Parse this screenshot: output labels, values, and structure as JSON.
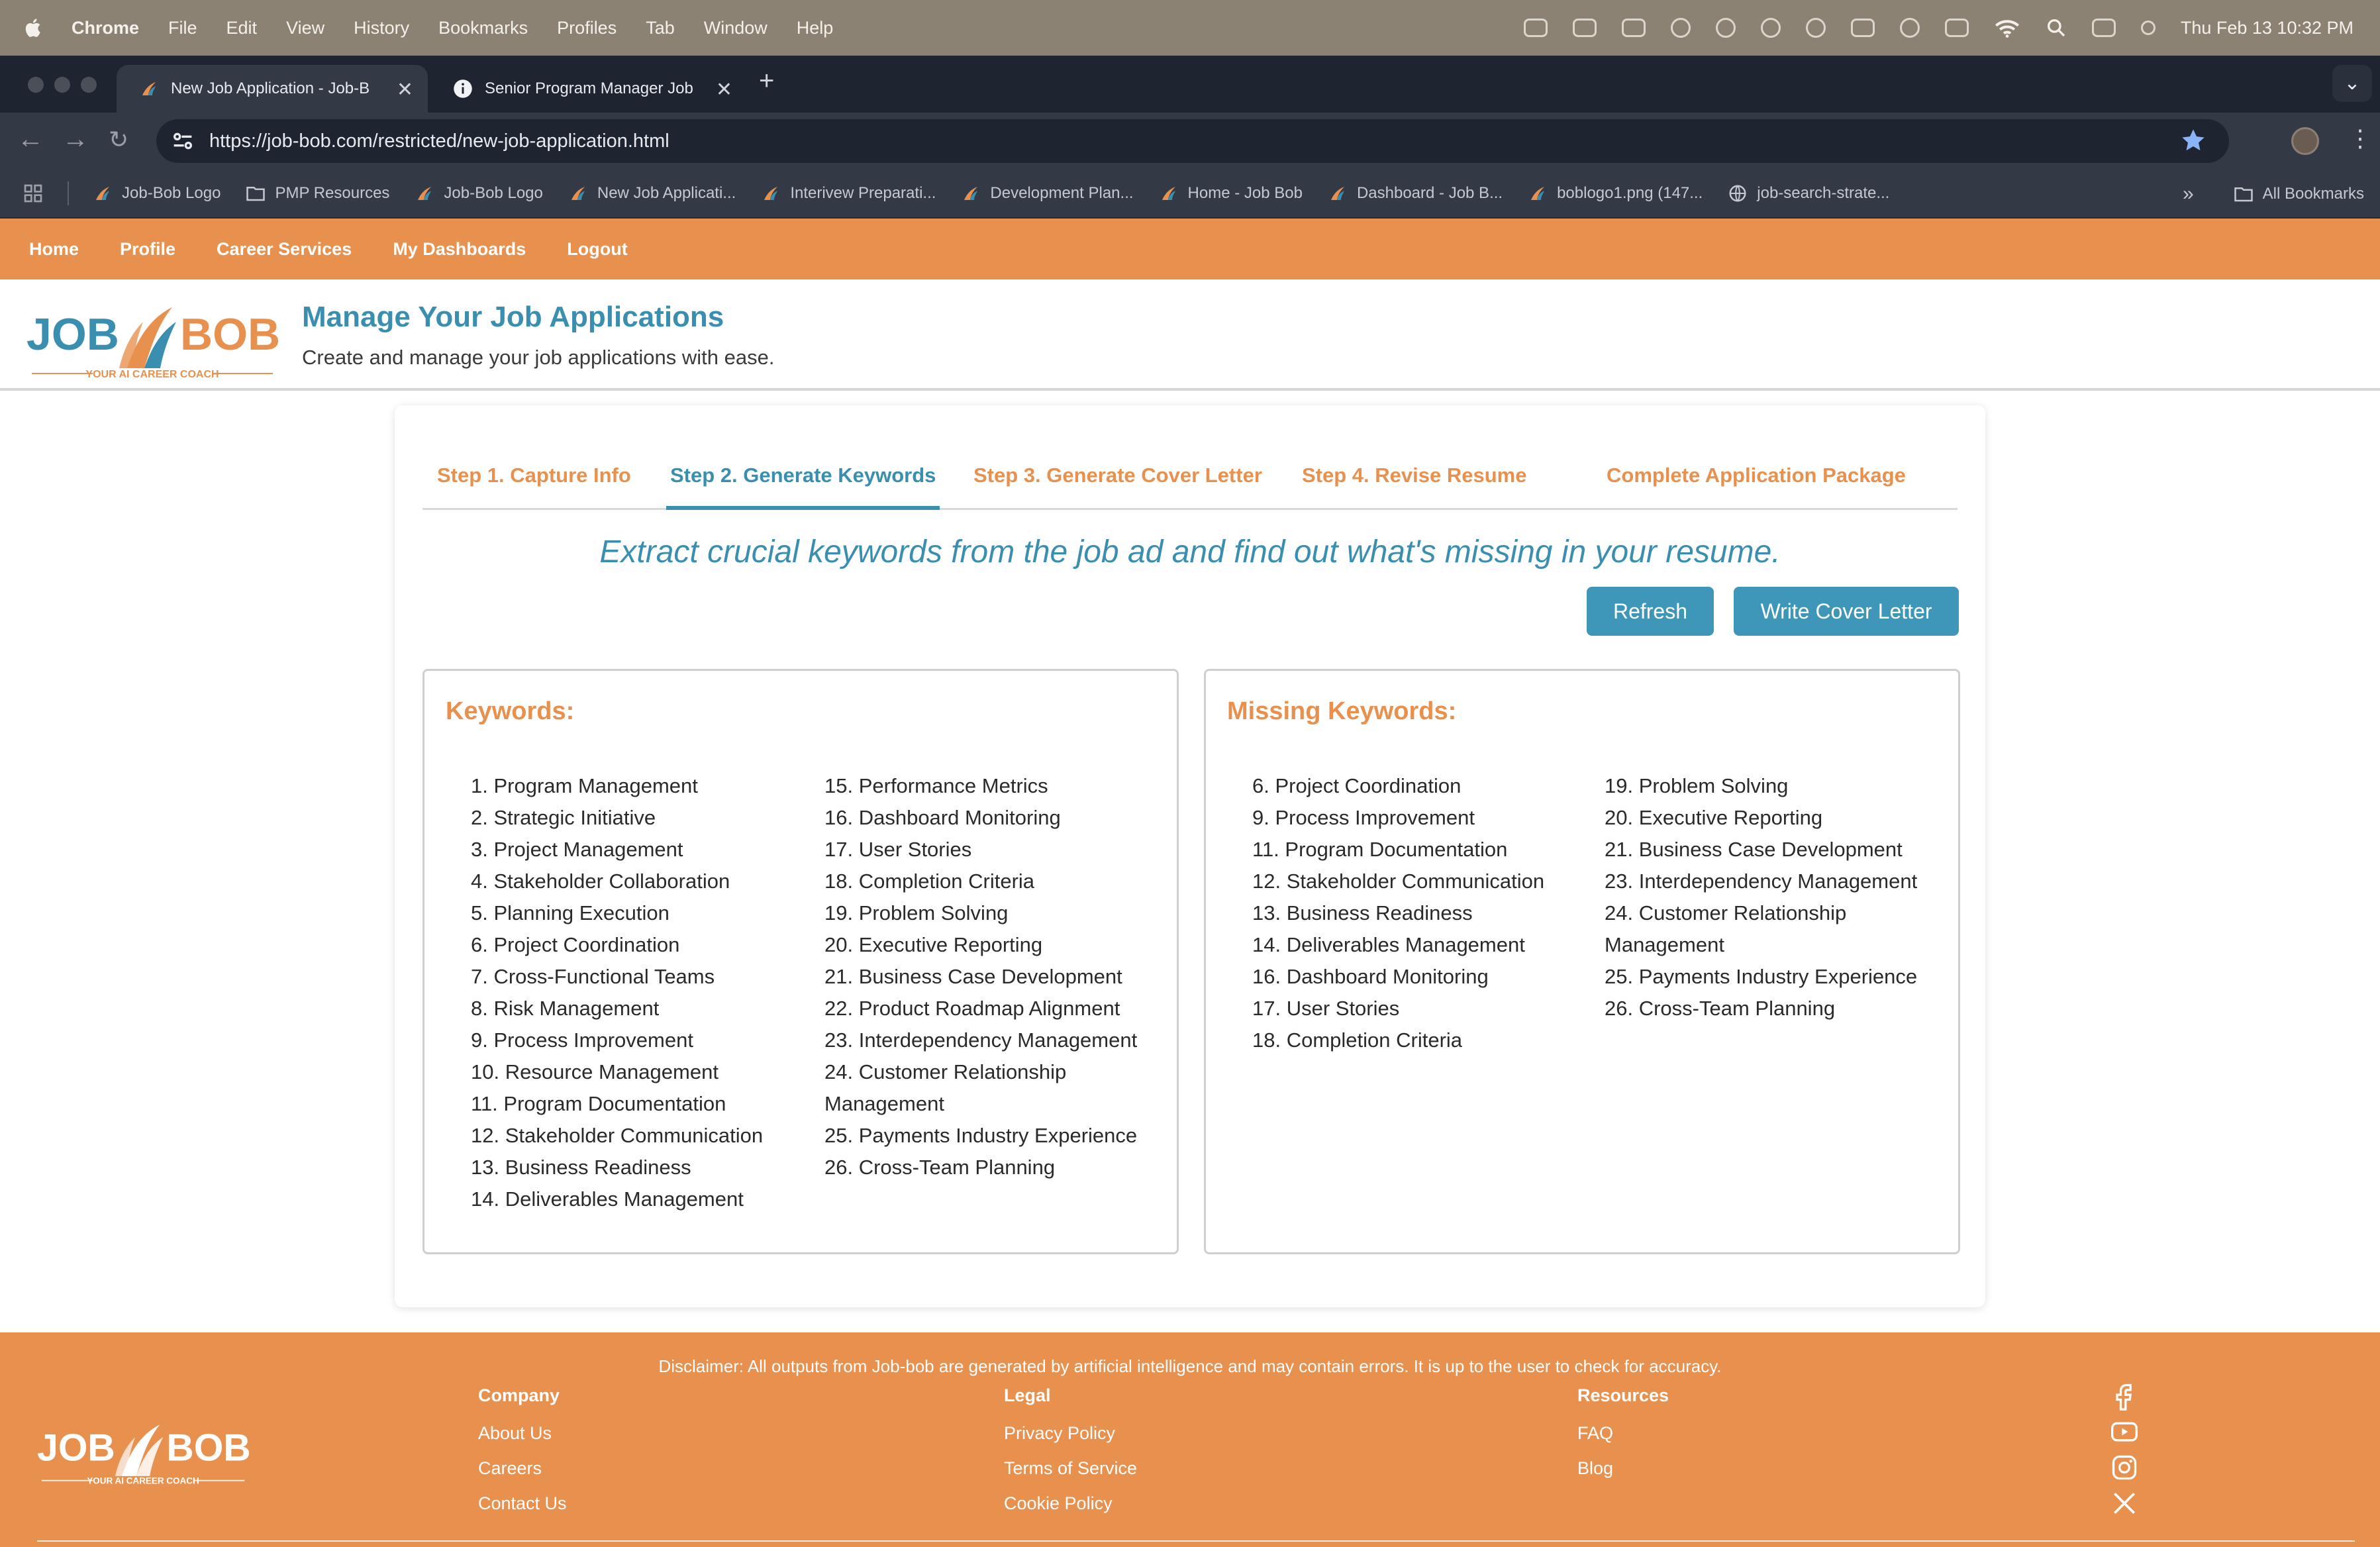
{
  "menubar": {
    "app": "Chrome",
    "items": [
      "File",
      "Edit",
      "View",
      "History",
      "Bookmarks",
      "Profiles",
      "Tab",
      "Window",
      "Help"
    ],
    "clock": "Thu Feb 13  10:32 PM"
  },
  "browser": {
    "tabs": [
      {
        "label": "New Job Application - Job-B",
        "active": true
      },
      {
        "label": "Senior Program Manager Job",
        "active": false
      }
    ],
    "url": "https://job-bob.com/restricted/new-job-application.html",
    "bookmarks": [
      "Job-Bob Logo",
      "PMP Resources",
      "Job-Bob Logo",
      "New Job Applicati...",
      "Interivew Preparati...",
      "Development Plan...",
      "Home - Job Bob",
      "Dashboard - Job B...",
      "boblogo1.png (147...",
      "job-search-strate..."
    ],
    "all_bookmarks": "All Bookmarks",
    "overflow": "»"
  },
  "nav": {
    "items": [
      "Home",
      "Profile",
      "Career Services",
      "My Dashboards",
      "Logout"
    ]
  },
  "brand": {
    "left": "JOB",
    "right": "BOB",
    "tagline": "YOUR AI CAREER COACH"
  },
  "header": {
    "title": "Manage Your Job Applications",
    "subtitle": "Create and manage your job applications with ease."
  },
  "steps": [
    "Step 1. Capture Info",
    "Step 2. Generate Keywords",
    "Step 3. Generate Cover Letter",
    "Step 4. Revise Resume",
    "Complete Application Package"
  ],
  "main": {
    "heading": "Extract crucial keywords from the job ad and find out what's missing in your resume.",
    "refresh_label": "Refresh",
    "cover_label": "Write Cover Letter"
  },
  "keywords": {
    "title": "Keywords:",
    "col1": [
      "1. Program Management",
      "2. Strategic Initiative",
      "3. Project Management",
      "4. Stakeholder Collaboration",
      "5. Planning Execution",
      "6. Project Coordination",
      "7. Cross-Functional Teams",
      "8. Risk Management",
      "9. Process Improvement",
      "10. Resource Management",
      "11. Program Documentation",
      "12. Stakeholder Communication",
      "13. Business Readiness",
      "14. Deliverables Management"
    ],
    "col2": [
      "15. Performance Metrics",
      "16. Dashboard Monitoring",
      "17. User Stories",
      "18. Completion Criteria",
      "19. Problem Solving",
      "20. Executive Reporting",
      "21. Business Case Development",
      "22. Product Roadmap Alignment",
      "23. Interdependency Management",
      "24. Customer Relationship Management",
      "25. Payments Industry Experience",
      "26. Cross-Team Planning"
    ]
  },
  "missing": {
    "title": "Missing Keywords:",
    "col1": [
      "6. Project Coordination",
      "9. Process Improvement",
      "11. Program Documentation",
      "12. Stakeholder Communication",
      "13. Business Readiness",
      "14. Deliverables Management",
      "16. Dashboard Monitoring",
      "17. User Stories",
      "18. Completion Criteria"
    ],
    "col2": [
      "19. Problem Solving",
      "20. Executive Reporting",
      "21. Business Case Development",
      "23. Interdependency Management",
      "24. Customer Relationship Management",
      "25. Payments Industry Experience",
      "26. Cross-Team Planning"
    ]
  },
  "footer": {
    "disclaimer": "Disclaimer: All outputs from Job-bob are generated by artificial intelligence and may contain errors. It is up to the user to check for accuracy.",
    "company": {
      "title": "Company",
      "links": [
        "About Us",
        "Careers",
        "Contact Us"
      ]
    },
    "legal": {
      "title": "Legal",
      "links": [
        "Privacy Policy",
        "Terms of Service",
        "Cookie Policy"
      ]
    },
    "resources": {
      "title": "Resources",
      "links": [
        "FAQ",
        "Blog"
      ]
    },
    "social_icons": [
      "facebook-icon",
      "youtube-icon",
      "instagram-icon",
      "x-icon"
    ]
  },
  "colors": {
    "accent_orange": "#e8914f",
    "accent_blue": "#3a8fb0",
    "button_blue": "#3e97b8"
  }
}
